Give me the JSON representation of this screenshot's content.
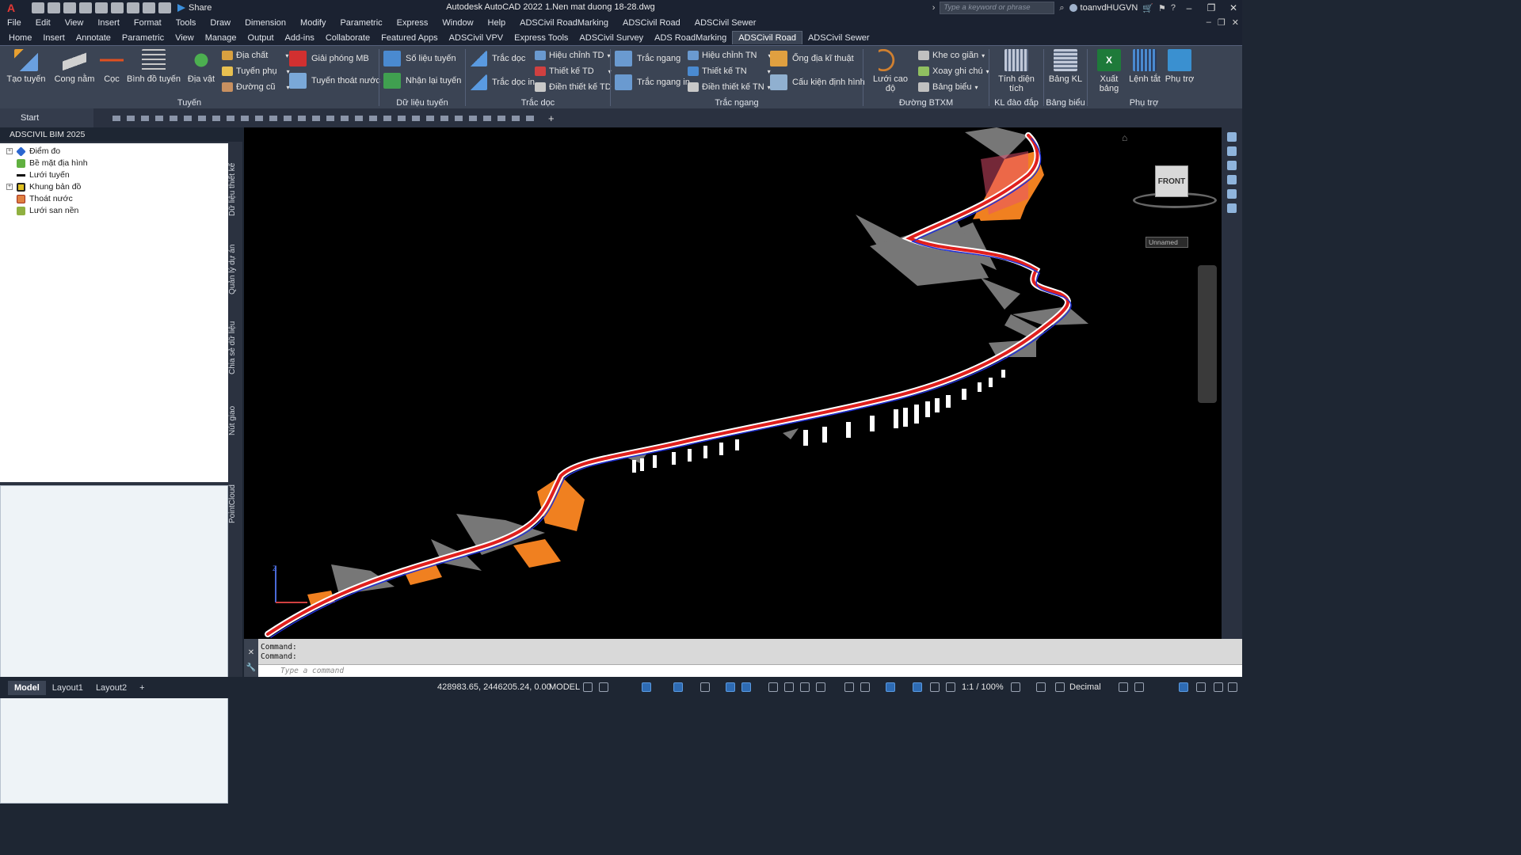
{
  "app": {
    "title": "Autodesk AutoCAD 2022    1.Nen mat duong 18-28.dwg",
    "share_label": "Share",
    "search_placeholder": "Type a keyword or phrase",
    "user": "toanvdHUGVN"
  },
  "menu": [
    "File",
    "Edit",
    "View",
    "Insert",
    "Format",
    "Tools",
    "Draw",
    "Dimension",
    "Modify",
    "Parametric",
    "Express",
    "Window",
    "Help",
    "ADSCivil RoadMarking",
    "ADSCivil Road",
    "ADSCivil Sewer"
  ],
  "ribbon_tabs": [
    "Home",
    "Insert",
    "Annotate",
    "Parametric",
    "View",
    "Manage",
    "Output",
    "Add-ins",
    "Collaborate",
    "Featured Apps",
    "ADSCivil VPV",
    "Express Tools",
    "ADSCivil Survey",
    "ADS RoadMarking",
    "ADSCivil Road",
    "ADSCivil Sewer"
  ],
  "active_tab": "ADSCivil Road",
  "ribbon": {
    "tuyen": {
      "label": "Tuyến",
      "tao_tuyen": "Tạo tuyến",
      "cong_nam": "Cong nằm",
      "coc": "Cọc",
      "binh_do_tuyen": "Bình đồ tuyến",
      "dia_vat": "Địa vật",
      "dia_chat": "Địa chất",
      "tuyen_phu": "Tuyến phụ",
      "duong_cu": "Đường cũ",
      "giai_phong_mb": "Giải phóng MB",
      "tuyen_thoat_nuoc": "Tuyến thoát nước"
    },
    "du_lieu_tuyen": {
      "label": "Dữ liệu tuyến",
      "so_lieu_tuyen": "Số liệu tuyến",
      "nhan_lai_tuyen": "Nhận lại tuyến"
    },
    "trac_doc": {
      "label": "Trắc dọc",
      "trac_doc": "Trắc dọc",
      "trac_doc_in": "Trắc dọc in",
      "hieu_chinh_td": "Hiệu chỉnh TD",
      "thiet_ke_td": "Thiết kế TD",
      "dien_thiet_ke_td": "Điền thiết kế TD"
    },
    "trac_ngang": {
      "label": "Trắc ngang",
      "trac_ngang": "Trắc ngang",
      "trac_ngang_in": "Trắc ngang in",
      "hieu_chinh_tn": "Hiệu chỉnh TN",
      "thiet_ke_tn": "Thiết kế TN",
      "dien_thiet_ke_tn": "Điền thiết kế TN",
      "ong_dia_ki_thuat": "Ống địa kĩ thuật",
      "cau_kien_dinh_hinh": "Cấu kiện định hình"
    },
    "duong_btxm": {
      "label": "Đường BTXM",
      "luoi_cao_do": "Lưới cao độ",
      "khe_co_gian": "Khe co giãn",
      "xoay_ghi_chu": "Xoay ghi chú",
      "bang_bieu": "Bảng biểu"
    },
    "kl_dao_dap": {
      "label": "KL đào đắp",
      "tinh_dien_tich": "Tính diện tích"
    },
    "bang_bieu": {
      "label": "Bảng biểu",
      "bang_kl": "Bảng KL"
    },
    "phu_tro": {
      "label": "Phụ trợ",
      "xuat_bang": "Xuất bảng",
      "lenh_tat": "Lệnh tắt",
      "phu_tro": "Phụ trợ"
    }
  },
  "filetabs": {
    "start": "Start"
  },
  "palette": {
    "title": "ADSCIVIL BIM 2025",
    "tree": [
      "Điểm đo",
      "Bề mặt địa hình",
      "Lưới tuyến",
      "Khung bản đồ",
      "Thoát nước",
      "Lưới san nền"
    ],
    "side_tabs": [
      "Dữ liệu thiết kế",
      "Quản lý dự án",
      "Chia sẻ dữ liệu",
      "Nút giao",
      "PointCloud"
    ]
  },
  "viewport": {
    "viewcube_face": "FRONT",
    "ucs_label": "Unnamed",
    "colors": {
      "road_red": "#e0201e",
      "road_blue": "#2030d8",
      "fill_orange": "#f08020",
      "terrain_grey": "#9a9a9a",
      "piers": "#ffffff"
    }
  },
  "command": {
    "history": [
      "Command:",
      "Command:"
    ],
    "placeholder": "Type a command"
  },
  "status": {
    "layouts": [
      "Model",
      "Layout1",
      "Layout2"
    ],
    "coords": "428983.65, 2446205.24, 0.00",
    "mode": "MODEL",
    "scale": "1:1 / 100%",
    "units": "Decimal"
  }
}
